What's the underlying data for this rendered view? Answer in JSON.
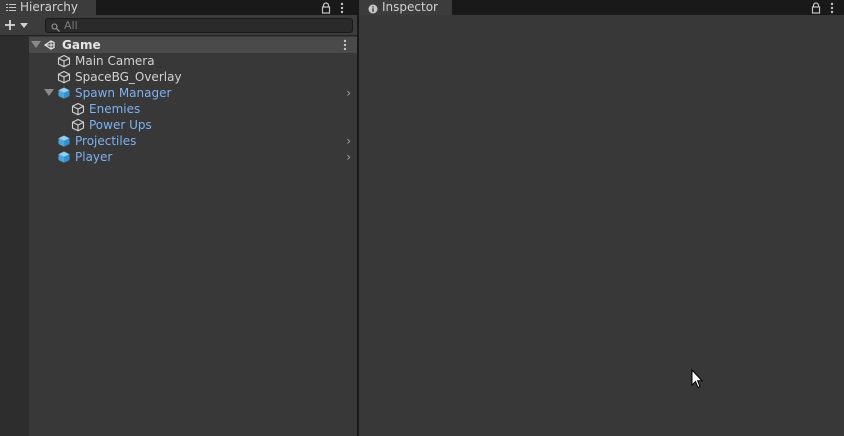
{
  "hierarchy": {
    "tab_label": "Hierarchy",
    "search_placeholder": "All",
    "scene": {
      "name": "Game"
    },
    "items": [
      {
        "name": "Main Camera"
      },
      {
        "name": "SpaceBG_Overlay"
      },
      {
        "name": "Spawn Manager"
      },
      {
        "name": "Enemies"
      },
      {
        "name": "Power Ups"
      },
      {
        "name": "Projectiles"
      },
      {
        "name": "Player"
      }
    ]
  },
  "inspector": {
    "tab_label": "Inspector"
  },
  "colors": {
    "prefab_text": "#7fb0f0",
    "prefab_icon": "#5fb6ea",
    "panel_bg": "#383838"
  }
}
